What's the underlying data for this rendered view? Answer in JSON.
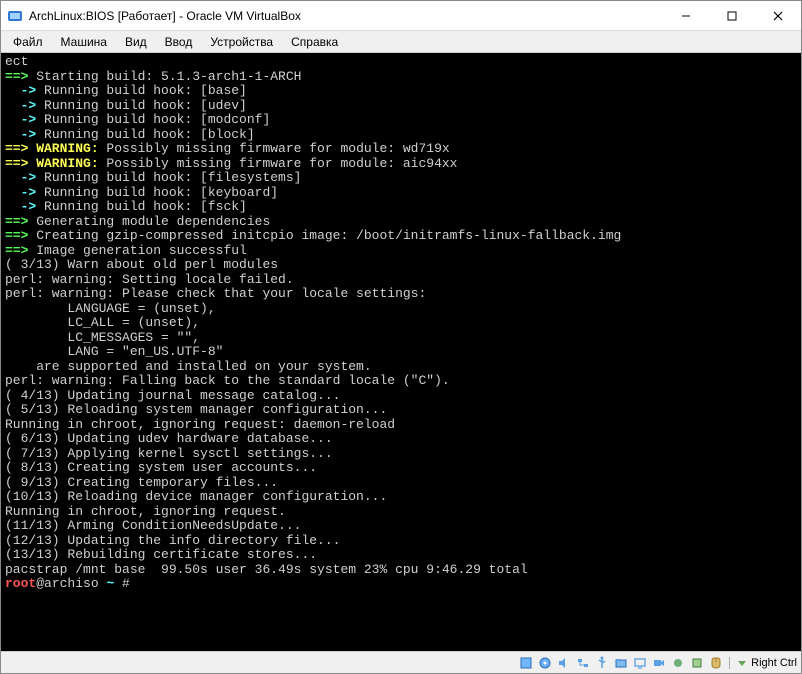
{
  "window": {
    "title": "ArchLinux:BIOS [Работает] - Oracle VM VirtualBox"
  },
  "menu": {
    "items": [
      "Файл",
      "Машина",
      "Вид",
      "Ввод",
      "Устройства",
      "Справка"
    ]
  },
  "terminal": {
    "lines": [
      {
        "segs": [
          {
            "t": "ect",
            "c": "white"
          }
        ]
      },
      {
        "segs": [
          {
            "t": "==> ",
            "c": "green"
          },
          {
            "t": "Starting build: 5.1.3-arch1-1-ARCH",
            "c": "white"
          }
        ]
      },
      {
        "segs": [
          {
            "t": "  -> ",
            "c": "cyan"
          },
          {
            "t": "Running build hook: [base]",
            "c": "white"
          }
        ]
      },
      {
        "segs": [
          {
            "t": "  -> ",
            "c": "cyan"
          },
          {
            "t": "Running build hook: [udev]",
            "c": "white"
          }
        ]
      },
      {
        "segs": [
          {
            "t": "  -> ",
            "c": "cyan"
          },
          {
            "t": "Running build hook: [modconf]",
            "c": "white"
          }
        ]
      },
      {
        "segs": [
          {
            "t": "  -> ",
            "c": "cyan"
          },
          {
            "t": "Running build hook: [block]",
            "c": "white"
          }
        ]
      },
      {
        "segs": [
          {
            "t": "==> WARNING: ",
            "c": "yellow"
          },
          {
            "t": "Possibly missing firmware for module: wd719x",
            "c": "white"
          }
        ]
      },
      {
        "segs": [
          {
            "t": "==> WARNING: ",
            "c": "yellow"
          },
          {
            "t": "Possibly missing firmware for module: aic94xx",
            "c": "white"
          }
        ]
      },
      {
        "segs": [
          {
            "t": "  -> ",
            "c": "cyan"
          },
          {
            "t": "Running build hook: [filesystems]",
            "c": "white"
          }
        ]
      },
      {
        "segs": [
          {
            "t": "  -> ",
            "c": "cyan"
          },
          {
            "t": "Running build hook: [keyboard]",
            "c": "white"
          }
        ]
      },
      {
        "segs": [
          {
            "t": "  -> ",
            "c": "cyan"
          },
          {
            "t": "Running build hook: [fsck]",
            "c": "white"
          }
        ]
      },
      {
        "segs": [
          {
            "t": "==> ",
            "c": "green"
          },
          {
            "t": "Generating module dependencies",
            "c": "white"
          }
        ]
      },
      {
        "segs": [
          {
            "t": "==> ",
            "c": "green"
          },
          {
            "t": "Creating gzip-compressed initcpio image: /boot/initramfs-linux-fallback.img",
            "c": "white"
          }
        ]
      },
      {
        "segs": [
          {
            "t": "==> ",
            "c": "green"
          },
          {
            "t": "Image generation successful",
            "c": "white"
          }
        ]
      },
      {
        "segs": [
          {
            "t": "( 3/13) Warn about old perl modules",
            "c": "white"
          }
        ]
      },
      {
        "segs": [
          {
            "t": "perl: warning: Setting locale failed.",
            "c": "white"
          }
        ]
      },
      {
        "segs": [
          {
            "t": "perl: warning: Please check that your locale settings:",
            "c": "white"
          }
        ]
      },
      {
        "segs": [
          {
            "t": "        LANGUAGE = (unset),",
            "c": "white"
          }
        ]
      },
      {
        "segs": [
          {
            "t": "        LC_ALL = (unset),",
            "c": "white"
          }
        ]
      },
      {
        "segs": [
          {
            "t": "        LC_MESSAGES = \"\",",
            "c": "white"
          }
        ]
      },
      {
        "segs": [
          {
            "t": "        LANG = \"en_US.UTF-8\"",
            "c": "white"
          }
        ]
      },
      {
        "segs": [
          {
            "t": "    are supported and installed on your system.",
            "c": "white"
          }
        ]
      },
      {
        "segs": [
          {
            "t": "perl: warning: Falling back to the standard locale (\"C\").",
            "c": "white"
          }
        ]
      },
      {
        "segs": [
          {
            "t": "( 4/13) Updating journal message catalog...",
            "c": "white"
          }
        ]
      },
      {
        "segs": [
          {
            "t": "( 5/13) Reloading system manager configuration...",
            "c": "white"
          }
        ]
      },
      {
        "segs": [
          {
            "t": "Running in chroot, ignoring request: daemon-reload",
            "c": "white"
          }
        ]
      },
      {
        "segs": [
          {
            "t": "( 6/13) Updating udev hardware database...",
            "c": "white"
          }
        ]
      },
      {
        "segs": [
          {
            "t": "( 7/13) Applying kernel sysctl settings...",
            "c": "white"
          }
        ]
      },
      {
        "segs": [
          {
            "t": "( 8/13) Creating system user accounts...",
            "c": "white"
          }
        ]
      },
      {
        "segs": [
          {
            "t": "( 9/13) Creating temporary files...",
            "c": "white"
          }
        ]
      },
      {
        "segs": [
          {
            "t": "(10/13) Reloading device manager configuration...",
            "c": "white"
          }
        ]
      },
      {
        "segs": [
          {
            "t": "Running in chroot, ignoring request.",
            "c": "white"
          }
        ]
      },
      {
        "segs": [
          {
            "t": "(11/13) Arming ConditionNeedsUpdate...",
            "c": "white"
          }
        ]
      },
      {
        "segs": [
          {
            "t": "(12/13) Updating the info directory file...",
            "c": "white"
          }
        ]
      },
      {
        "segs": [
          {
            "t": "(13/13) Rebuilding certificate stores...",
            "c": "white"
          }
        ]
      },
      {
        "segs": [
          {
            "t": "pacstrap /mnt base  99.50s user 36.49s system 23% cpu 9:46.29 total",
            "c": "white"
          }
        ]
      },
      {
        "segs": [
          {
            "t": "root",
            "c": "red"
          },
          {
            "t": "@archiso ",
            "c": "white"
          },
          {
            "t": "~",
            "c": "cyan"
          },
          {
            "t": " # ",
            "c": "white"
          }
        ]
      }
    ]
  },
  "statusbar": {
    "host_key": "Right Ctrl",
    "icons": [
      "disk-icon",
      "optical-icon",
      "audio-icon",
      "network-icon",
      "usb-icon",
      "shared-folder-icon",
      "display-icon",
      "video-icon",
      "recording-icon",
      "cpu-icon",
      "mouse-icon"
    ]
  }
}
